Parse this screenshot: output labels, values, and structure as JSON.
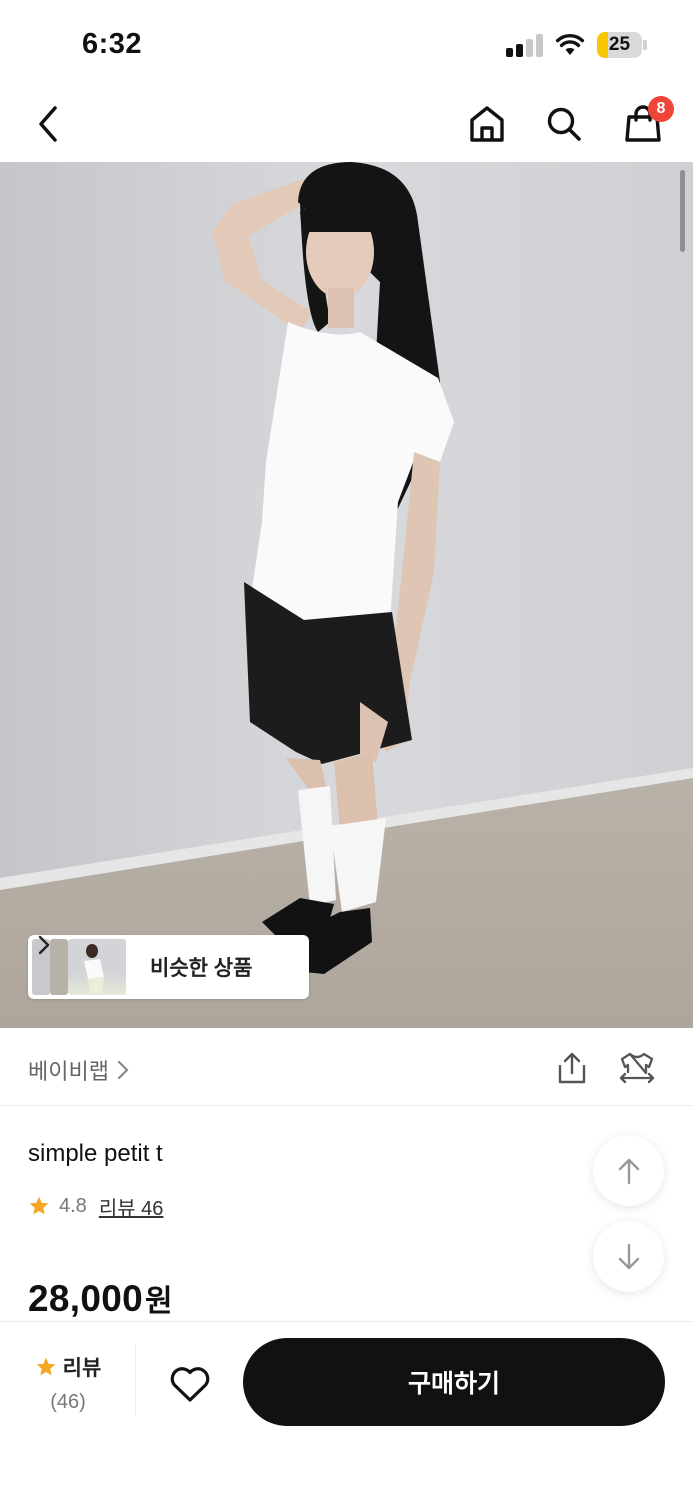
{
  "status_bar": {
    "time": "6:32",
    "battery_level": "25",
    "battery_fraction": 0.25,
    "icons": [
      "cellular-signal-icon",
      "wifi-icon",
      "battery-icon"
    ]
  },
  "header": {
    "icons": [
      "back-arrow-icon",
      "home-icon",
      "search-icon",
      "shopping-bag-icon"
    ],
    "cart_count": "8"
  },
  "hero": {
    "similar_products_label": "비슷한 상품"
  },
  "brand": {
    "name": "베이비랩",
    "icons": [
      "share-icon",
      "clothes-fitting-icon"
    ]
  },
  "product": {
    "title": "simple petit t",
    "rating": "4.8",
    "review_link": "리뷰 46",
    "price": "28,000",
    "currency": "원"
  },
  "float_buttons": [
    "arrow-up-icon",
    "arrow-down-icon"
  ],
  "bottom_bar": {
    "review_label": "리뷰",
    "review_count": "(46)",
    "buy_label": "구매하기"
  },
  "colors": {
    "star": "#f5a623",
    "badge": "#f04438",
    "battery_fill": "#f7c800",
    "buy_button": "#111111"
  }
}
